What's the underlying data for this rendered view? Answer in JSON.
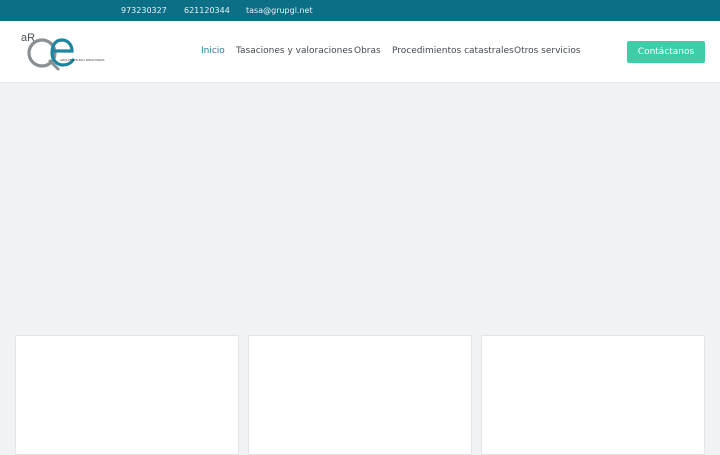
{
  "topbar": {
    "phone_1": "973230327",
    "phone_2": "621120344",
    "email": "tasa@grupgl.net",
    "background": "#0d6f86"
  },
  "logo": {
    "prefix": "aR",
    "mark": "Qe",
    "tagline": "ARQUITECTURA I ENGINYERIA"
  },
  "nav": {
    "items": [
      {
        "label": "Inicio",
        "active": true
      },
      {
        "label": "Tasaciones y valoraciones",
        "active": false
      },
      {
        "label": "Obras",
        "active": false
      },
      {
        "label": "Procedimientos catastrales",
        "active": false
      },
      {
        "label": "Otros servicios",
        "active": false
      }
    ],
    "active_color": "#1a7f99"
  },
  "cta": {
    "label": "Contáctanos",
    "color": "#3fcca7"
  }
}
